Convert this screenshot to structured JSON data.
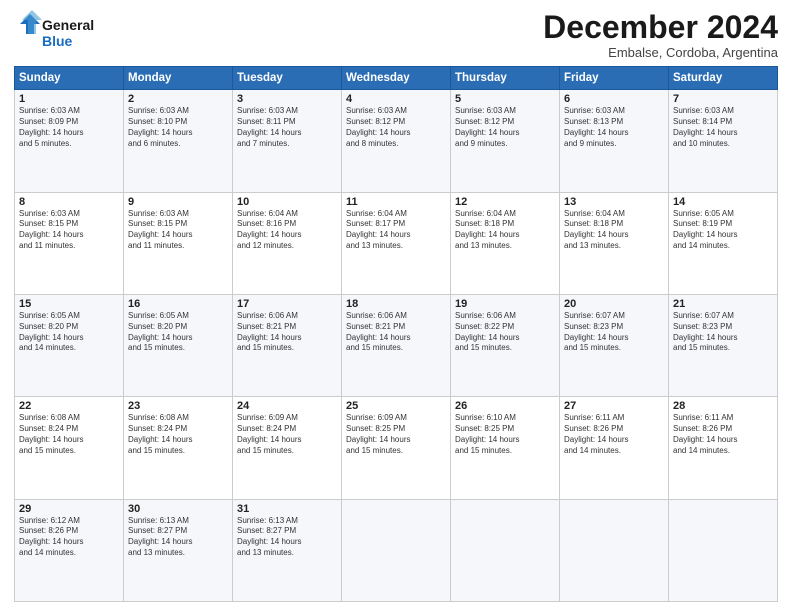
{
  "logo": {
    "line1": "General",
    "line2": "Blue"
  },
  "title": "December 2024",
  "subtitle": "Embalse, Cordoba, Argentina",
  "days_header": [
    "Sunday",
    "Monday",
    "Tuesday",
    "Wednesday",
    "Thursday",
    "Friday",
    "Saturday"
  ],
  "weeks": [
    [
      {
        "day": "1",
        "info": "Sunrise: 6:03 AM\nSunset: 8:09 PM\nDaylight: 14 hours\nand 5 minutes."
      },
      {
        "day": "2",
        "info": "Sunrise: 6:03 AM\nSunset: 8:10 PM\nDaylight: 14 hours\nand 6 minutes."
      },
      {
        "day": "3",
        "info": "Sunrise: 6:03 AM\nSunset: 8:11 PM\nDaylight: 14 hours\nand 7 minutes."
      },
      {
        "day": "4",
        "info": "Sunrise: 6:03 AM\nSunset: 8:12 PM\nDaylight: 14 hours\nand 8 minutes."
      },
      {
        "day": "5",
        "info": "Sunrise: 6:03 AM\nSunset: 8:12 PM\nDaylight: 14 hours\nand 9 minutes."
      },
      {
        "day": "6",
        "info": "Sunrise: 6:03 AM\nSunset: 8:13 PM\nDaylight: 14 hours\nand 9 minutes."
      },
      {
        "day": "7",
        "info": "Sunrise: 6:03 AM\nSunset: 8:14 PM\nDaylight: 14 hours\nand 10 minutes."
      }
    ],
    [
      {
        "day": "8",
        "info": "Sunrise: 6:03 AM\nSunset: 8:15 PM\nDaylight: 14 hours\nand 11 minutes."
      },
      {
        "day": "9",
        "info": "Sunrise: 6:03 AM\nSunset: 8:15 PM\nDaylight: 14 hours\nand 11 minutes."
      },
      {
        "day": "10",
        "info": "Sunrise: 6:04 AM\nSunset: 8:16 PM\nDaylight: 14 hours\nand 12 minutes."
      },
      {
        "day": "11",
        "info": "Sunrise: 6:04 AM\nSunset: 8:17 PM\nDaylight: 14 hours\nand 13 minutes."
      },
      {
        "day": "12",
        "info": "Sunrise: 6:04 AM\nSunset: 8:18 PM\nDaylight: 14 hours\nand 13 minutes."
      },
      {
        "day": "13",
        "info": "Sunrise: 6:04 AM\nSunset: 8:18 PM\nDaylight: 14 hours\nand 13 minutes."
      },
      {
        "day": "14",
        "info": "Sunrise: 6:05 AM\nSunset: 8:19 PM\nDaylight: 14 hours\nand 14 minutes."
      }
    ],
    [
      {
        "day": "15",
        "info": "Sunrise: 6:05 AM\nSunset: 8:20 PM\nDaylight: 14 hours\nand 14 minutes."
      },
      {
        "day": "16",
        "info": "Sunrise: 6:05 AM\nSunset: 8:20 PM\nDaylight: 14 hours\nand 15 minutes."
      },
      {
        "day": "17",
        "info": "Sunrise: 6:06 AM\nSunset: 8:21 PM\nDaylight: 14 hours\nand 15 minutes."
      },
      {
        "day": "18",
        "info": "Sunrise: 6:06 AM\nSunset: 8:21 PM\nDaylight: 14 hours\nand 15 minutes."
      },
      {
        "day": "19",
        "info": "Sunrise: 6:06 AM\nSunset: 8:22 PM\nDaylight: 14 hours\nand 15 minutes."
      },
      {
        "day": "20",
        "info": "Sunrise: 6:07 AM\nSunset: 8:23 PM\nDaylight: 14 hours\nand 15 minutes."
      },
      {
        "day": "21",
        "info": "Sunrise: 6:07 AM\nSunset: 8:23 PM\nDaylight: 14 hours\nand 15 minutes."
      }
    ],
    [
      {
        "day": "22",
        "info": "Sunrise: 6:08 AM\nSunset: 8:24 PM\nDaylight: 14 hours\nand 15 minutes."
      },
      {
        "day": "23",
        "info": "Sunrise: 6:08 AM\nSunset: 8:24 PM\nDaylight: 14 hours\nand 15 minutes."
      },
      {
        "day": "24",
        "info": "Sunrise: 6:09 AM\nSunset: 8:24 PM\nDaylight: 14 hours\nand 15 minutes."
      },
      {
        "day": "25",
        "info": "Sunrise: 6:09 AM\nSunset: 8:25 PM\nDaylight: 14 hours\nand 15 minutes."
      },
      {
        "day": "26",
        "info": "Sunrise: 6:10 AM\nSunset: 8:25 PM\nDaylight: 14 hours\nand 15 minutes."
      },
      {
        "day": "27",
        "info": "Sunrise: 6:11 AM\nSunset: 8:26 PM\nDaylight: 14 hours\nand 14 minutes."
      },
      {
        "day": "28",
        "info": "Sunrise: 6:11 AM\nSunset: 8:26 PM\nDaylight: 14 hours\nand 14 minutes."
      }
    ],
    [
      {
        "day": "29",
        "info": "Sunrise: 6:12 AM\nSunset: 8:26 PM\nDaylight: 14 hours\nand 14 minutes."
      },
      {
        "day": "30",
        "info": "Sunrise: 6:13 AM\nSunset: 8:27 PM\nDaylight: 14 hours\nand 13 minutes."
      },
      {
        "day": "31",
        "info": "Sunrise: 6:13 AM\nSunset: 8:27 PM\nDaylight: 14 hours\nand 13 minutes."
      },
      null,
      null,
      null,
      null
    ]
  ]
}
